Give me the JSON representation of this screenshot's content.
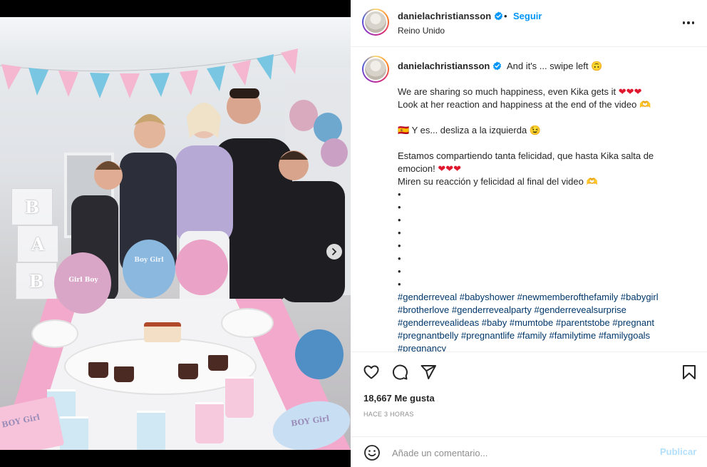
{
  "header": {
    "username": "danielachristiansson",
    "separator": "•",
    "follow_label": "Seguir",
    "location": "Reino Unido"
  },
  "post": {
    "photo_texts": {
      "balloon_left": "Girl Boy",
      "balloon_center": "Boy Girl",
      "napkin_left": "BOY Girl",
      "napkin_right": "BOY Girl",
      "box_letters": [
        "B",
        "A",
        "B"
      ]
    }
  },
  "caption": {
    "username": "danielachristiansson",
    "intro": "And it's ... swipe left 🙃",
    "en_line1": "We are sharing so much happiness, even Kika gets it",
    "hearts": "❤❤❤",
    "en_line2": "Look at her reaction and happiness at the end of the video 🫶",
    "es_intro": "🇪🇸 Y es... desliza a la izquierda 😉",
    "es_line1": "Estamos compartiendo tanta felicidad, que hasta Kika salta de emocion!",
    "es_line2": "Miren su reacción y felicidad al final del video 🫶",
    "bullets": [
      "•",
      "•",
      "•",
      "•",
      "•",
      "•",
      "•",
      "•",
      "•"
    ],
    "hashtags_line1": "#genderreveal #babyshower #newmemberofthefamily #babygirl",
    "hashtags_line2": "#brotherlove #genderrevealparty #genderrevealsurprise",
    "hashtags_line3": "#genderrevealideas #baby #mumtobe #parentstobe #pregnant",
    "hashtags_line4": "#pregnantbelly #pregnantlife #family #familytime #familygoals",
    "hashtags_line5": "#pregnancy"
  },
  "engagement": {
    "likes": "18,667 Me gusta",
    "time": "HACE 3 HORAS"
  },
  "comment": {
    "placeholder": "Añade un comentario...",
    "publish_label": "Publicar"
  },
  "colors": {
    "accent": "#0095f6",
    "link": "#00376b",
    "heart": "#e0182d",
    "muted": "#8e8e8e",
    "publish_disabled": "#b2dffc"
  }
}
